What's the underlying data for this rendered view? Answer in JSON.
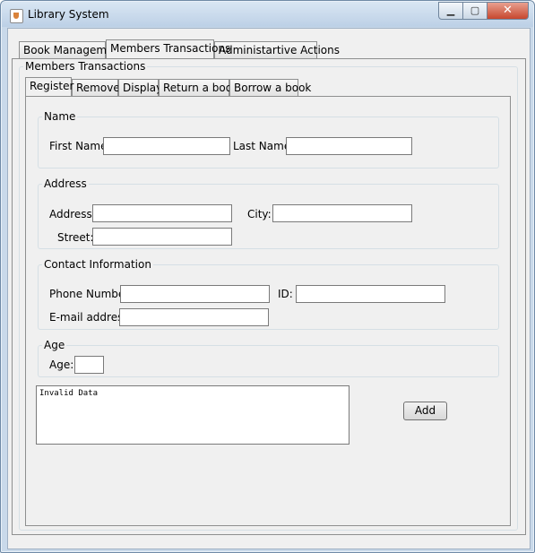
{
  "window": {
    "title": "Library System",
    "controls": {
      "minimize": "▁",
      "maximize": "▢",
      "close": "✕"
    }
  },
  "main_tabs": [
    {
      "label": "Book Management"
    },
    {
      "label": "Members Transactions"
    },
    {
      "label": "Administartive Actions"
    }
  ],
  "section_title": "Members Transactions",
  "sub_tabs": [
    {
      "label": "Register"
    },
    {
      "label": "Remove"
    },
    {
      "label": "Display"
    },
    {
      "label": "Return a book"
    },
    {
      "label": "Borrow a book"
    }
  ],
  "form": {
    "name": {
      "legend": "Name",
      "first_name_label": "First Name:",
      "first_name_value": "",
      "last_name_label": "Last Name:",
      "last_name_value": ""
    },
    "address": {
      "legend": "Address",
      "address_label": "Address:",
      "address_value": "",
      "city_label": "City:",
      "city_value": "",
      "street_label": "Street:",
      "street_value": ""
    },
    "contact": {
      "legend": "Contact Information",
      "phone_label": "Phone Number:",
      "phone_value": "",
      "id_label": "ID:",
      "id_value": "",
      "email_label": "E-mail address:",
      "email_value": ""
    },
    "age": {
      "legend": "Age",
      "age_label": "Age:",
      "age_value": ""
    },
    "message": "Invalid Data",
    "add_button": "Add"
  }
}
